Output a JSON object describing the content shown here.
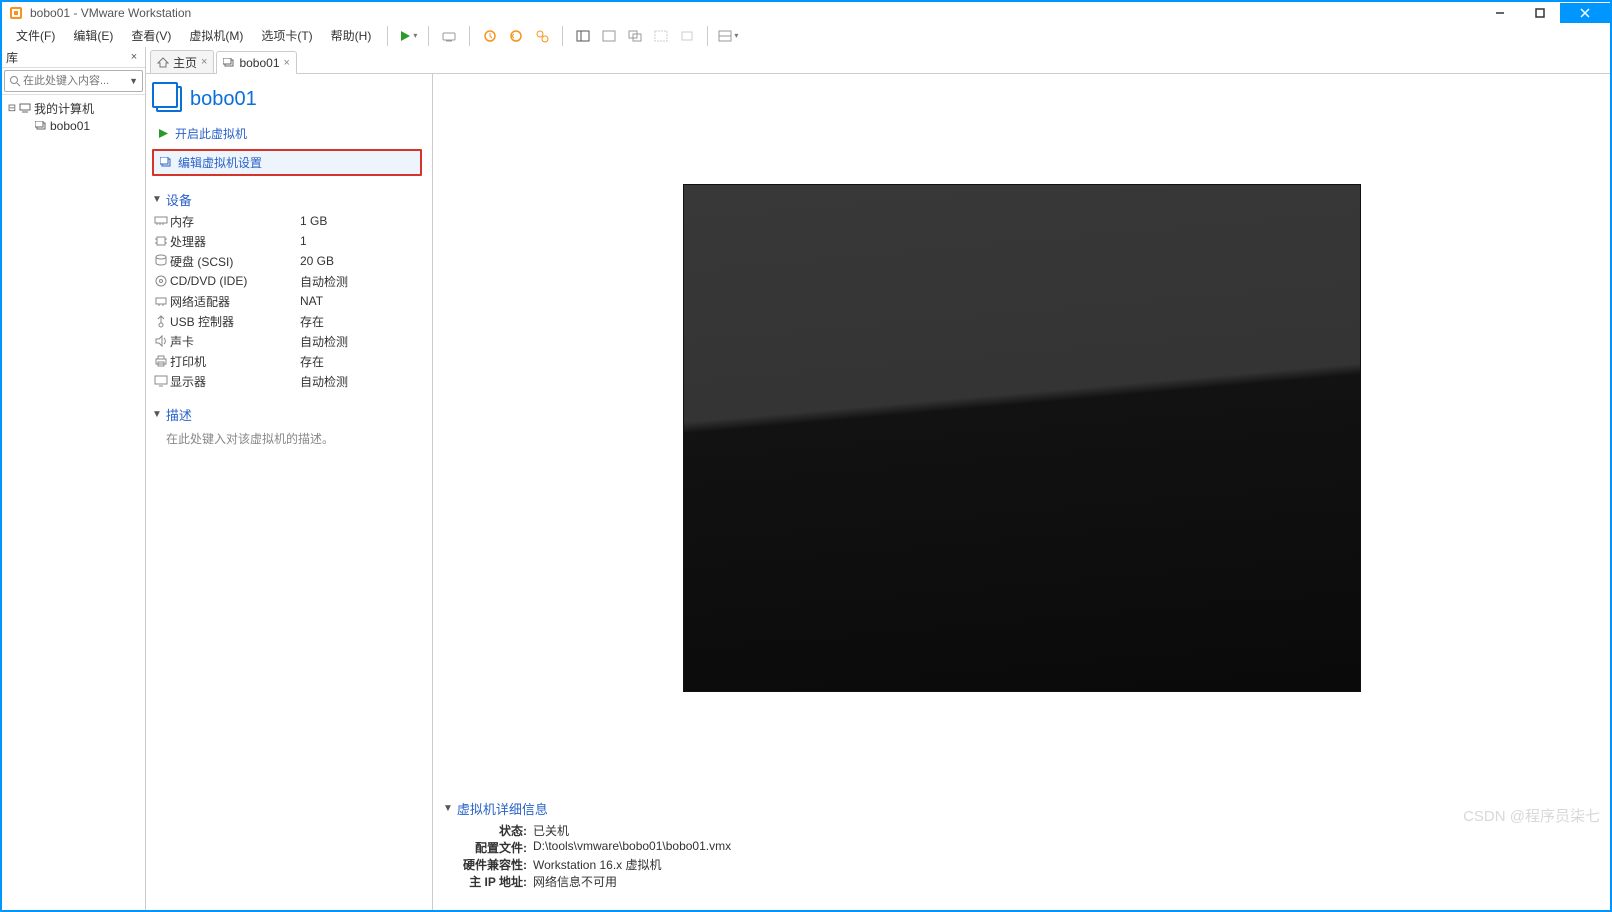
{
  "window": {
    "title": "bobo01 - VMware Workstation"
  },
  "menu": {
    "file": "文件(F)",
    "edit": "编辑(E)",
    "view": "查看(V)",
    "vm": "虚拟机(M)",
    "tabs": "选项卡(T)",
    "help": "帮助(H)"
  },
  "sidebar": {
    "title": "库",
    "search_placeholder": "在此处键入内容...",
    "root": "我的计算机",
    "child": "bobo01"
  },
  "tabs": {
    "home": "主页",
    "vm": "bobo01"
  },
  "vm": {
    "name": "bobo01",
    "power_on": "开启此虚拟机",
    "edit_settings": "编辑虚拟机设置"
  },
  "devices": {
    "header": "设备",
    "rows": [
      {
        "label": "内存",
        "value": "1 GB",
        "icon": "memory"
      },
      {
        "label": "处理器",
        "value": "1",
        "icon": "cpu"
      },
      {
        "label": "硬盘 (SCSI)",
        "value": "20 GB",
        "icon": "disk"
      },
      {
        "label": "CD/DVD (IDE)",
        "value": "自动检测",
        "icon": "cd"
      },
      {
        "label": "网络适配器",
        "value": "NAT",
        "icon": "net"
      },
      {
        "label": "USB 控制器",
        "value": "存在",
        "icon": "usb"
      },
      {
        "label": "声卡",
        "value": "自动检测",
        "icon": "sound"
      },
      {
        "label": "打印机",
        "value": "存在",
        "icon": "printer"
      },
      {
        "label": "显示器",
        "value": "自动检测",
        "icon": "display"
      }
    ]
  },
  "description": {
    "header": "描述",
    "placeholder": "在此处键入对该虚拟机的描述。"
  },
  "details": {
    "header": "虚拟机详细信息",
    "state_k": "状态:",
    "state_v": "已关机",
    "config_k": "配置文件:",
    "config_v": "D:\\tools\\vmware\\bobo01\\bobo01.vmx",
    "compat_k": "硬件兼容性:",
    "compat_v": "Workstation 16.x 虚拟机",
    "ip_k": "主 IP 地址:",
    "ip_v": "网络信息不可用"
  },
  "watermark": "CSDN @程序员柒七"
}
